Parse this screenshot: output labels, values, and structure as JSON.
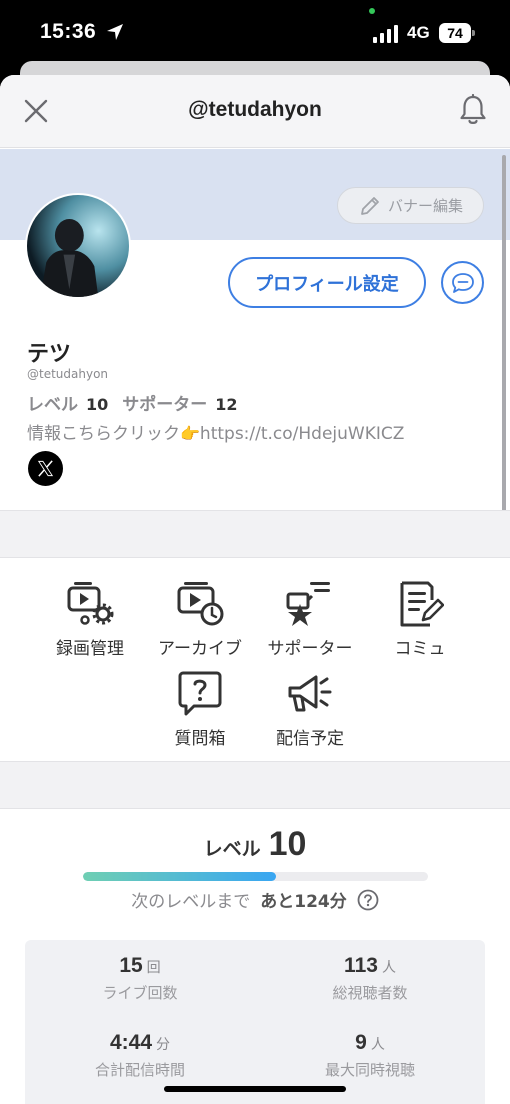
{
  "status_bar": {
    "time": "15:36",
    "network": "4G",
    "battery": "74"
  },
  "nav": {
    "title": "@tetudahyon"
  },
  "banner": {
    "edit_label": "バナー編集"
  },
  "profile": {
    "settings_button": "プロフィール設定",
    "name": "テツ",
    "handle": "@tetudahyon",
    "level_label": "レベル",
    "level_value": "10",
    "supporter_label": "サポーター",
    "supporter_value": "12",
    "bio_text": "情報こちらクリック",
    "bio_emoji": "👉",
    "bio_link": "https://t.co/HdejuWKICZ"
  },
  "menu": {
    "items": [
      {
        "label": "録画管理",
        "icon": "recording-manage-icon"
      },
      {
        "label": "アーカイブ",
        "icon": "archive-icon"
      },
      {
        "label": "サポーター",
        "icon": "supporter-icon"
      },
      {
        "label": "コミュ",
        "icon": "community-icon"
      },
      {
        "label": "質問箱",
        "icon": "question-box-icon"
      },
      {
        "label": "配信予定",
        "icon": "megaphone-icon"
      }
    ]
  },
  "level": {
    "label": "レベル",
    "value": "10",
    "progress": 0.56,
    "next_label": "次のレベルまで",
    "remaining": "あと124分"
  },
  "stats": [
    {
      "value": "15",
      "unit": "回",
      "label": "ライブ回数"
    },
    {
      "value": "113",
      "unit": "人",
      "label": "総視聴者数"
    },
    {
      "value": "4:44",
      "unit": "分",
      "label": "合計配信時間"
    },
    {
      "value": "9",
      "unit": "人",
      "label": "最大同時視聴"
    }
  ],
  "colors": {
    "accent": "#3e7fe3",
    "banner": "#d9e1f1",
    "progress_start": "#6fcfb3",
    "progress_end": "#39a6f2"
  }
}
